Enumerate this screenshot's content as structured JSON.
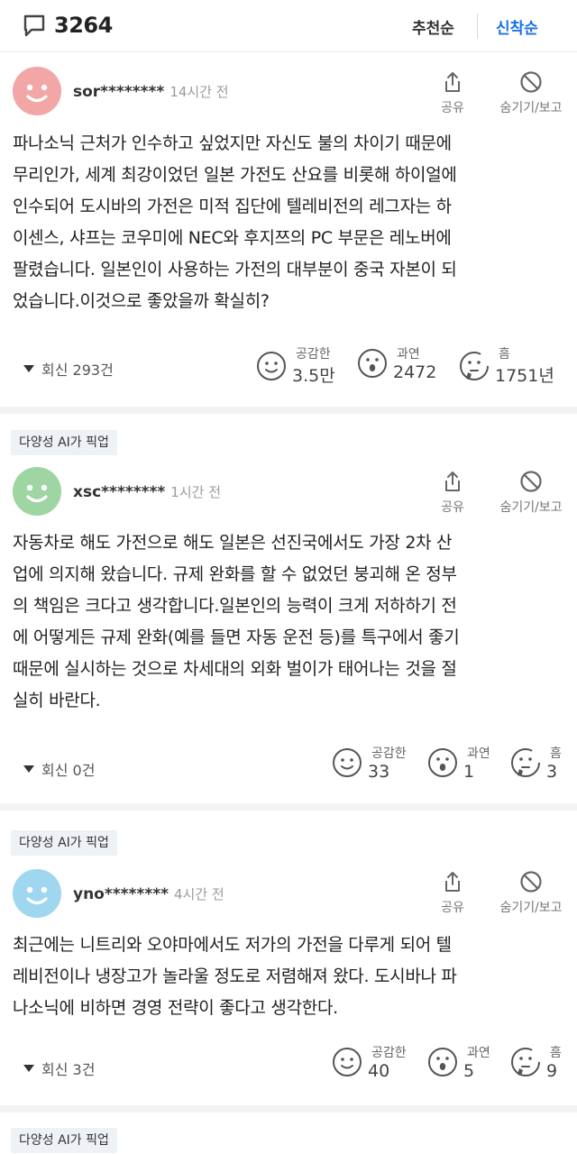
{
  "header": {
    "comment_count": "3264",
    "sort_recommend": "추천순",
    "sort_latest": "신착순",
    "accent": "#1a73e8"
  },
  "actions": {
    "share": "공유",
    "hide_report": "숨기기/보고"
  },
  "badge_text": "다양성 AI가 픽업",
  "comments": [
    {
      "user": "sor********",
      "time": "14시간 전",
      "avatar_color": "#f2a6a6",
      "lines": [
        "파나소닉 근처가 인수하고 싶었지만 자신도 불의 차이기 때문에",
        "무리인가, 세계 최강이었던 일본 가전도 산요를 비롯해 하이얼에",
        "인수되어 도시바의 가전은 미적 집단에 텔레비전의 레그자는 하",
        "이센스, 샤프는 코우미에 NEC와 후지쯔의 PC 부문은 레노버에",
        "팔렸습니다. 일본인이 사용하는 가전의 대부분이 중국 자본이 되",
        "었습니다.이것으로 좋았을까 확실히?"
      ],
      "replies": "회신 293건",
      "reactions": [
        {
          "label": "공감한",
          "value": "3.5만"
        },
        {
          "label": "과연",
          "value": "2472"
        },
        {
          "label": "흠",
          "value": "1751년"
        }
      ]
    },
    {
      "user": "xsc********",
      "time": "1시간 전",
      "avatar_color": "#9ed5a3",
      "lines": [
        "자동차로 해도 가전으로 해도 일본은 선진국에서도 가장 2차 산",
        "업에 의지해 왔습니다. 규제 완화를 할 수 없었던 붕괴해 온 정부",
        "의 책임은 크다고 생각합니다.일본인의 능력이 크게 저하하기 전",
        "에 어떻게든 규제 완화(예를 들면 자동 운전 등)를 특구에서 좋기",
        "때문에 실시하는 것으로 차세대의 외화 벌이가 태어나는 것을 절",
        "실히 바란다."
      ],
      "replies": "회신 0건",
      "reactions": [
        {
          "label": "공감한",
          "value": "33"
        },
        {
          "label": "과연",
          "value": "1"
        },
        {
          "label": "흠",
          "value": "3"
        }
      ]
    },
    {
      "user": "yno********",
      "time": "4시간 전",
      "avatar_color": "#9fd6f0",
      "lines": [
        "최근에는 니트리와 오야마에서도 저가의 가전을 다루게 되어 텔",
        "레비전이나 냉장고가 놀라울 정도로 저렴해져 왔다. 도시바나 파",
        "나소닉에 비하면 경영 전략이 좋다고 생각한다."
      ],
      "replies": "회신 3건",
      "reactions": [
        {
          "label": "공감한",
          "value": "40"
        },
        {
          "label": "과연",
          "value": "5"
        },
        {
          "label": "흠",
          "value": "9"
        }
      ]
    }
  ]
}
